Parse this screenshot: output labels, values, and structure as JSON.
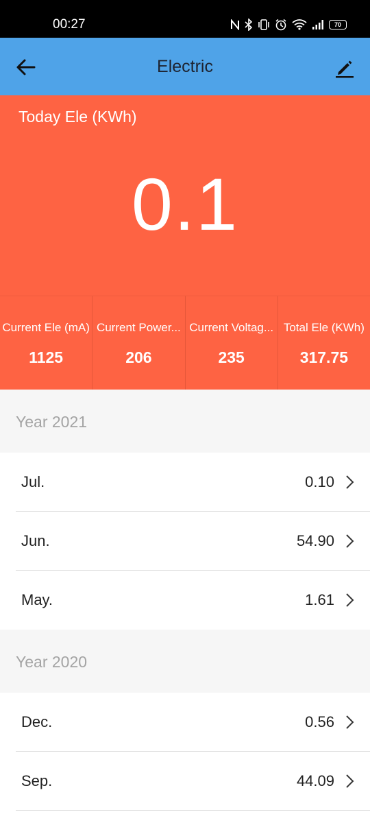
{
  "status_bar": {
    "time": "00:27",
    "battery": "70"
  },
  "app_bar": {
    "title": "Electric"
  },
  "hero": {
    "label": "Today Ele (KWh)",
    "value": "0.1"
  },
  "stats": [
    {
      "label": "Current Ele (mA)",
      "value": "1125"
    },
    {
      "label": "Current Power...",
      "value": "206"
    },
    {
      "label": "Current Voltag...",
      "value": "235"
    },
    {
      "label": "Total Ele (KWh)",
      "value": "317.75"
    }
  ],
  "sections": [
    {
      "title": "Year 2021",
      "rows": [
        {
          "month": "Jul.",
          "value": "0.10"
        },
        {
          "month": "Jun.",
          "value": "54.90"
        },
        {
          "month": "May.",
          "value": "1.61"
        }
      ]
    },
    {
      "title": "Year 2020",
      "rows": [
        {
          "month": "Dec.",
          "value": "0.56"
        },
        {
          "month": "Sep.",
          "value": "44.09"
        }
      ]
    }
  ],
  "colors": {
    "app_bar": "#4fa3e8",
    "hero": "#fe6343",
    "section_bg": "#f6f6f6"
  }
}
